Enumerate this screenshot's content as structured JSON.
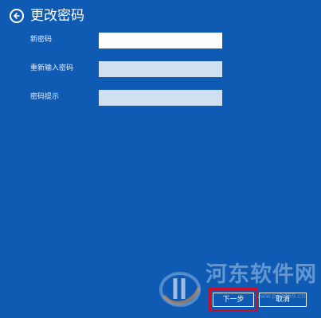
{
  "header": {
    "title": "更改密码",
    "back_icon": "arrow-left-icon"
  },
  "form": {
    "fields": [
      {
        "label": "新密码",
        "value": ""
      },
      {
        "label": "重新输入密码",
        "value": ""
      },
      {
        "label": "密码提示",
        "value": ""
      }
    ]
  },
  "footer": {
    "next_label": "下一步",
    "cancel_label": "取消"
  },
  "watermark": {
    "text": "河东软件网",
    "url": "www.pc0359.cn"
  },
  "colors": {
    "background": "#0f5bb3",
    "active_field": "#ffffff",
    "inactive_field": "#cfe0f3",
    "highlight": "#c8102e"
  }
}
